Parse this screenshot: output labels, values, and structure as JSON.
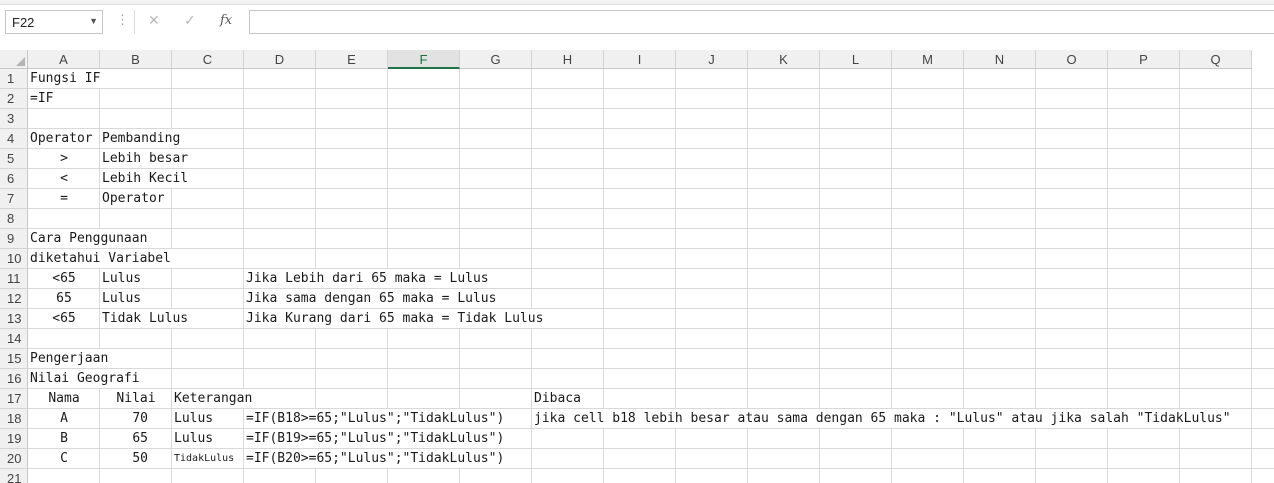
{
  "formula_bar": {
    "name_box": "F22",
    "formula": "",
    "icons": {
      "more": "vertical-ellipsis-icon",
      "cancel": "cancel-x-icon",
      "enter": "check-mark-icon",
      "insert_function": "fx-icon"
    }
  },
  "columns": [
    "A",
    "B",
    "C",
    "D",
    "E",
    "F",
    "G",
    "H",
    "I",
    "J",
    "K",
    "L",
    "M",
    "N",
    "O",
    "P",
    "Q"
  ],
  "active_column": "F",
  "rows": [
    "1",
    "2",
    "3",
    "4",
    "5",
    "6",
    "7",
    "8",
    "9",
    "10",
    "11",
    "12",
    "13",
    "14",
    "15",
    "16",
    "17",
    "18",
    "19",
    "20",
    "21"
  ],
  "cells": {
    "A1": " Fungsi IF",
    "A2": "=IF",
    "A4": "Operator",
    "B4": "Pembanding",
    "A5": ">",
    "B5": "Lebih besar",
    "A6": "<",
    "B6": "Lebih Kecil",
    "A7": "=",
    "B7": "Operator",
    "A9": "Cara Penggunaan",
    "A10": "diketahui Variabel",
    "A11": "<65",
    "B11": "Lulus",
    "D11": "Jika Lebih dari 65 maka = Lulus",
    "A12": "65",
    "B12": "Lulus",
    "D12": "Jika sama dengan 65 maka = Lulus",
    "A13": "<65",
    "B13": "Tidak Lulus",
    "D13": "Jika Kurang dari 65 maka = Tidak Lulus",
    "A15": "Pengerjaan",
    "A16": "Nilai Geografi",
    "A17": "Nama",
    "B17": "Nilai",
    "C17": "Keterangan",
    "H17": "Dibaca",
    "A18": "A",
    "B18": "70",
    "C18": "Lulus",
    "D18": "=IF(B18>=65;\"Lulus\";\"TidakLulus\")",
    "H18": "jika cell b18 lebih besar atau sama dengan 65 maka : \"Lulus\" atau jika salah \"TidakLulus\"",
    "A19": "B",
    "B19": "65",
    "C19": "Lulus",
    "D19": "=IF(B19>=65;\"Lulus\";\"TidakLulus\")",
    "A20": "C",
    "B20": "50",
    "C20": "TidakLulus",
    "D20": "=IF(B20>=65;\"Lulus\";\"TidakLulus\")"
  }
}
